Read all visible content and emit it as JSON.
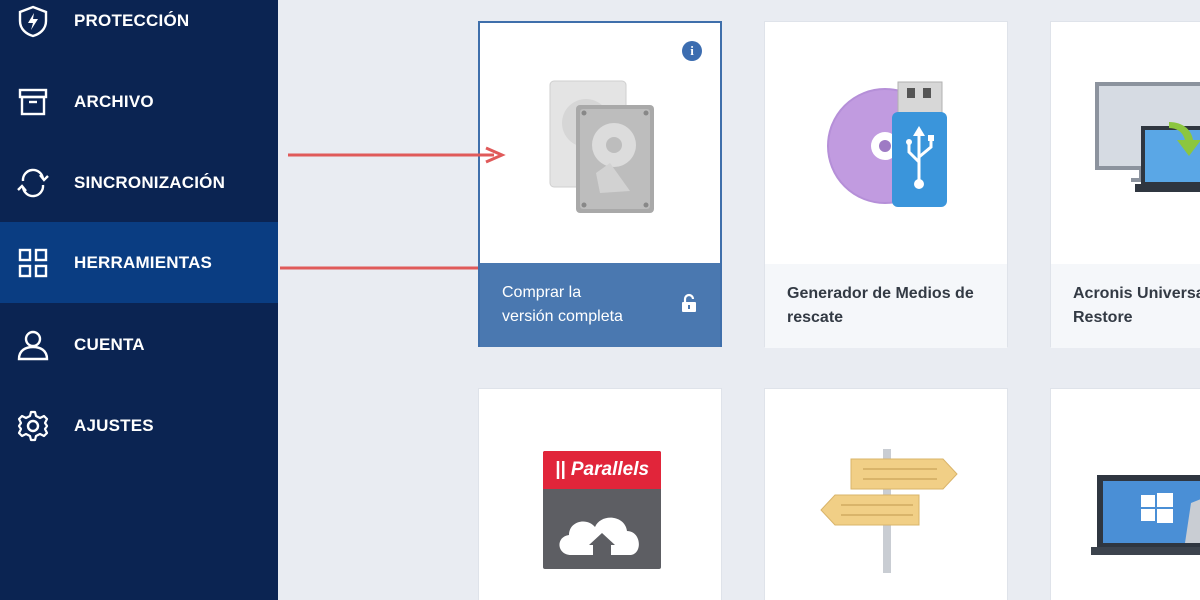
{
  "sidebar": {
    "items": [
      {
        "label": "PROTECCIÓN",
        "icon": "shield-icon"
      },
      {
        "label": "ARCHIVO",
        "icon": "archive-icon"
      },
      {
        "label": "SINCRONIZACIÓN",
        "icon": "sync-icon"
      },
      {
        "label": "HERRAMIENTAS",
        "icon": "grid-icon",
        "active": true
      },
      {
        "label": "CUENTA",
        "icon": "user-icon"
      },
      {
        "label": "AJUSTES",
        "icon": "gear-icon"
      }
    ]
  },
  "cards": [
    {
      "title_line1": "Comprar la",
      "title_line2": "versión completa",
      "icon": "hard-drives-icon"
    },
    {
      "title_line1": "Generador de Medios de",
      "title_line2": "rescate",
      "icon": "usb-disc-icon"
    },
    {
      "title_line1": "Acronis Universa",
      "title_line2": "Restore",
      "icon": "monitor-transfer-icon"
    }
  ],
  "row2": {
    "parallels_logo": "|| Parallels",
    "icons": [
      "parallels-icon",
      "signpost-icon",
      "windows-laptop-icon"
    ]
  },
  "colors": {
    "sidebar": "#0b2452",
    "active": "#0a3d82",
    "accent": "#4a78b0",
    "arrow": "#e05a5a"
  }
}
